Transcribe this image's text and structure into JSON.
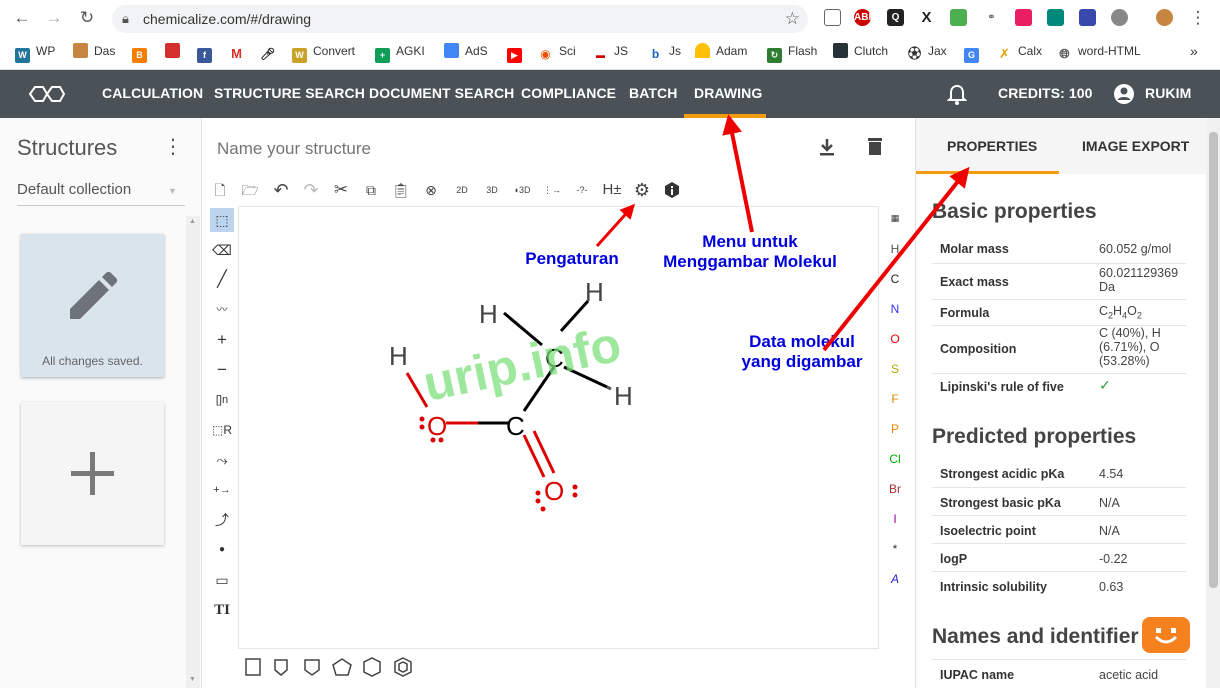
{
  "browser": {
    "url": "chemicalize.com/#/drawing",
    "bookmarks": [
      "WP",
      "Das",
      "",
      "",
      "",
      "",
      "",
      "Convert",
      "AGKI",
      "AdS",
      "",
      "Sci",
      "JS",
      "Js",
      "Adam",
      "Flash",
      "Clutch",
      "Jax",
      "",
      "Calx",
      "word-HTML"
    ]
  },
  "appnav": {
    "items": [
      "CALCULATION",
      "STRUCTURE SEARCH",
      "DOCUMENT SEARCH",
      "COMPLIANCE",
      "BATCH",
      "DRAWING"
    ],
    "credits": "CREDITS: 100",
    "user": "RUKIM",
    "accent": "#f39c12"
  },
  "left": {
    "title": "Structures",
    "collection": "Default collection",
    "card_status": "All changes saved."
  },
  "editor": {
    "name_placeholder": "Name your structure",
    "elements": [
      "H",
      "C",
      "N",
      "O",
      "S",
      "F",
      "P",
      "Cl",
      "Br",
      "I",
      "*",
      "A"
    ],
    "molecule_atoms": [
      "H",
      "H",
      "C",
      "H",
      "H",
      "O",
      "C",
      "O"
    ],
    "watermark": "urip.info"
  },
  "right": {
    "tabs": [
      "PROPERTIES",
      "IMAGE EXPORT"
    ],
    "basic_title": "Basic properties",
    "basic": [
      {
        "key": "Molar mass",
        "value": "60.052 g/mol"
      },
      {
        "key": "Exact mass",
        "value": "60.021129369 Da"
      },
      {
        "key": "Formula",
        "value": "C2H4O2"
      },
      {
        "key": "Composition",
        "value": "C (40%), H (6.71%), O (53.28%)"
      },
      {
        "key": "Lipinski's rule of five",
        "value": "✓"
      }
    ],
    "predicted_title": "Predicted properties",
    "predicted": [
      {
        "key": "Strongest acidic pKa",
        "value": "4.54"
      },
      {
        "key": "Strongest basic pKa",
        "value": "N/A"
      },
      {
        "key": "Isoelectric point",
        "value": "N/A"
      },
      {
        "key": "logP",
        "value": "-0.22"
      },
      {
        "key": "Intrinsic solubility",
        "value": "0.63"
      }
    ],
    "names_title": "Names and identifier",
    "names": [
      {
        "key": "IUPAC name",
        "value": "acetic acid"
      }
    ]
  },
  "annotations": {
    "settings": "Pengaturan",
    "menu": "Menu untuk Menggambar Molekul",
    "data": "Data molekul yang digambar"
  }
}
